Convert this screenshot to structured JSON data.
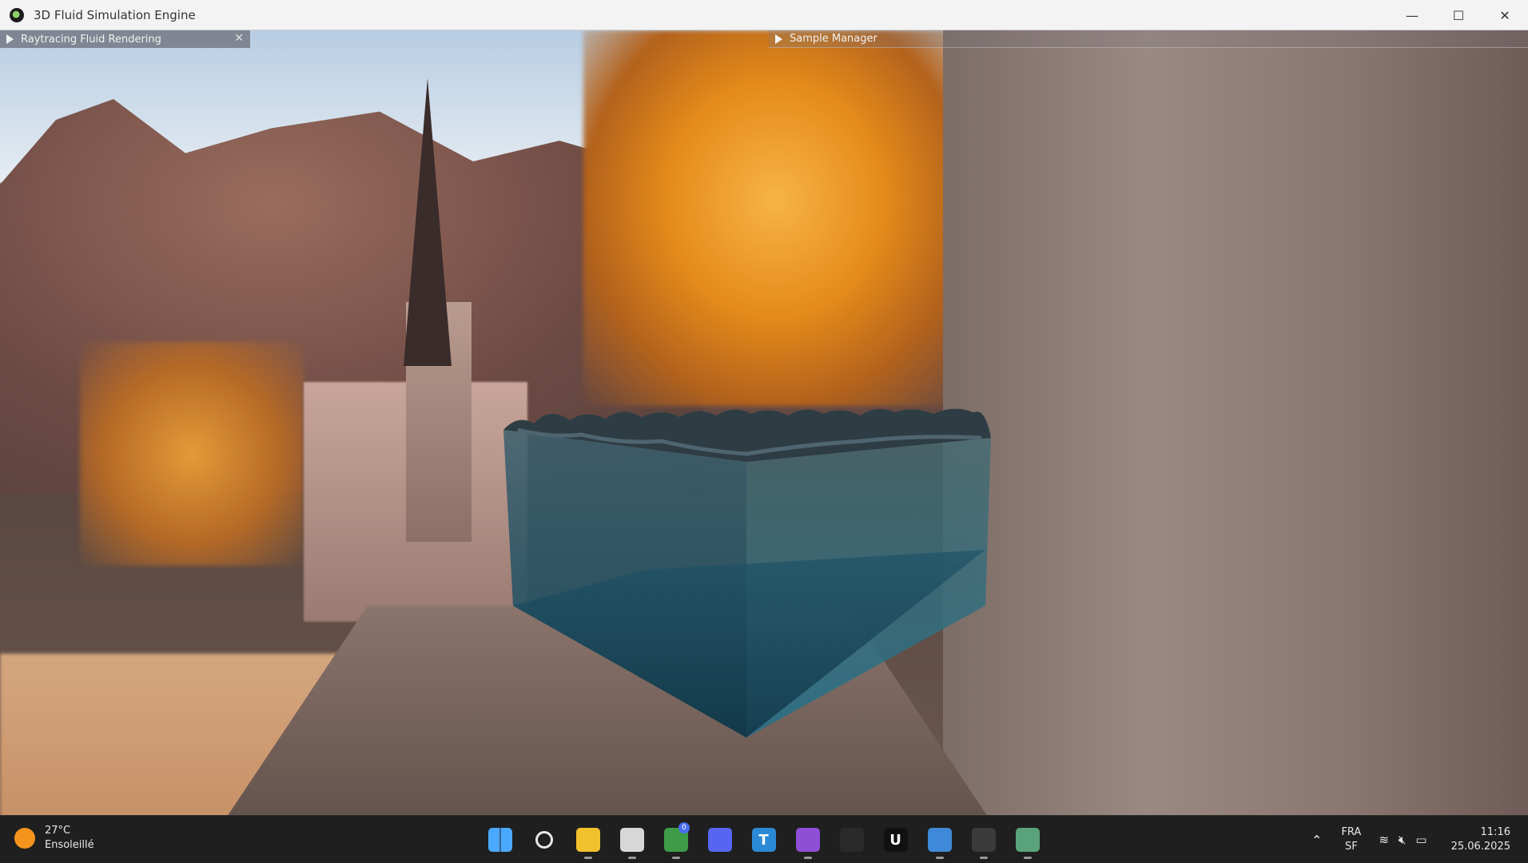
{
  "window": {
    "title": "3D Fluid Simulation Engine",
    "controls": {
      "minimize": "—",
      "maximize": "☐",
      "close": "✕"
    }
  },
  "panels": {
    "raytracing": {
      "label": "Raytracing Fluid Rendering",
      "close": "✕"
    },
    "sample_manager": {
      "label": "Sample Manager"
    }
  },
  "taskbar": {
    "weather": {
      "temp": "27°C",
      "condition": "Ensoleillé"
    },
    "apps": [
      {
        "name": "windows-start",
        "icon": "windows-icon",
        "color": "#2e8cf0",
        "running": false
      },
      {
        "name": "search",
        "icon": "search-icon",
        "color": "#1f1f1f",
        "running": false
      },
      {
        "name": "file-explorer",
        "icon": "folder-icon",
        "color": "#f2c12e",
        "running": true
      },
      {
        "name": "snipping-tool",
        "icon": "snipping-icon",
        "color": "#d7d7d7",
        "running": true
      },
      {
        "name": "chrome",
        "icon": "chrome-icon",
        "color": "#3e9b48",
        "running": true,
        "badge": "0"
      },
      {
        "name": "discord",
        "icon": "discord-icon",
        "color": "#5865f2",
        "running": false
      },
      {
        "name": "typora",
        "icon": "text-icon",
        "color": "#2b8ad6",
        "running": false,
        "letter": "T"
      },
      {
        "name": "visual-studio",
        "icon": "visual-studio-icon",
        "color": "#8d4fd6",
        "running": true
      },
      {
        "name": "unity",
        "icon": "unity-icon",
        "color": "#2a2a2a",
        "running": false
      },
      {
        "name": "unreal",
        "icon": "unreal-icon",
        "color": "#111111",
        "running": false,
        "letter": "U"
      },
      {
        "name": "app-window",
        "icon": "window-icon",
        "color": "#3f8ad8",
        "running": true
      },
      {
        "name": "terminal",
        "icon": "terminal-icon",
        "color": "#3a3a3a",
        "running": true
      },
      {
        "name": "fluid-engine",
        "icon": "app-window-icon",
        "color": "#5aa37a",
        "running": true
      }
    ],
    "lang": {
      "line1": "FRA",
      "line2": "SF"
    },
    "clock": {
      "time": "11:16",
      "date": "25.06.2025"
    }
  }
}
